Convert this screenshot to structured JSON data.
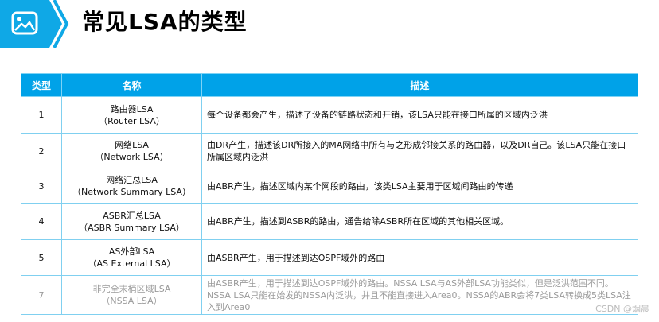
{
  "title": "常见LSA的类型",
  "table": {
    "headers": [
      "类型",
      "名称",
      "描述"
    ],
    "rows": [
      {
        "num": "1",
        "name_cn": "路由器LSA",
        "name_en": "（Router LSA）",
        "desc": "每个设备都会产生，描述了设备的链路状态和开销，该LSA只能在接口所属的区域内泛洪"
      },
      {
        "num": "2",
        "name_cn": "网络LSA",
        "name_en": "（Network LSA）",
        "desc": "由DR产生，描述该DR所接入的MA网络中所有与之形成邻接关系的路由器，以及DR自己。该LSA只能在接口所属区域内泛洪"
      },
      {
        "num": "3",
        "name_cn": "网络汇总LSA",
        "name_en": "（Network Summary LSA）",
        "desc": "由ABR产生，描述区域内某个网段的路由，该类LSA主要用于区域间路由的传递"
      },
      {
        "num": "4",
        "name_cn": "ASBR汇总LSA",
        "name_en": "（ASBR Summary LSA）",
        "desc": "由ABR产生，描述到ASBR的路由，通告给除ASBR所在区域的其他相关区域。"
      },
      {
        "num": "5",
        "name_cn": "AS外部LSA",
        "name_en": "（AS External LSA）",
        "desc": "由ASBR产生，用于描述到达OSPF域外的路由"
      },
      {
        "num": "7",
        "name_cn": "非完全末梢区域LSA",
        "name_en": "（NSSA LSA）",
        "desc": "由ASBR产生，用于描述到达OSPF域外的路由。NSSA LSA与AS外部LSA功能类似，但是泛洪范围不同。NSSA LSA只能在始发的NSSA内泛洪，并且不能直接进入Area0。NSSA的ABR会将7类LSA转换成5类LSA注入到Area0"
      }
    ]
  },
  "watermark": "CSDN @烟晨",
  "colors": {
    "header_bg": "#00a2e8",
    "border": "#80d0f0",
    "logo": "#0fa8e6"
  },
  "icons": {
    "logo": "image-icon"
  }
}
